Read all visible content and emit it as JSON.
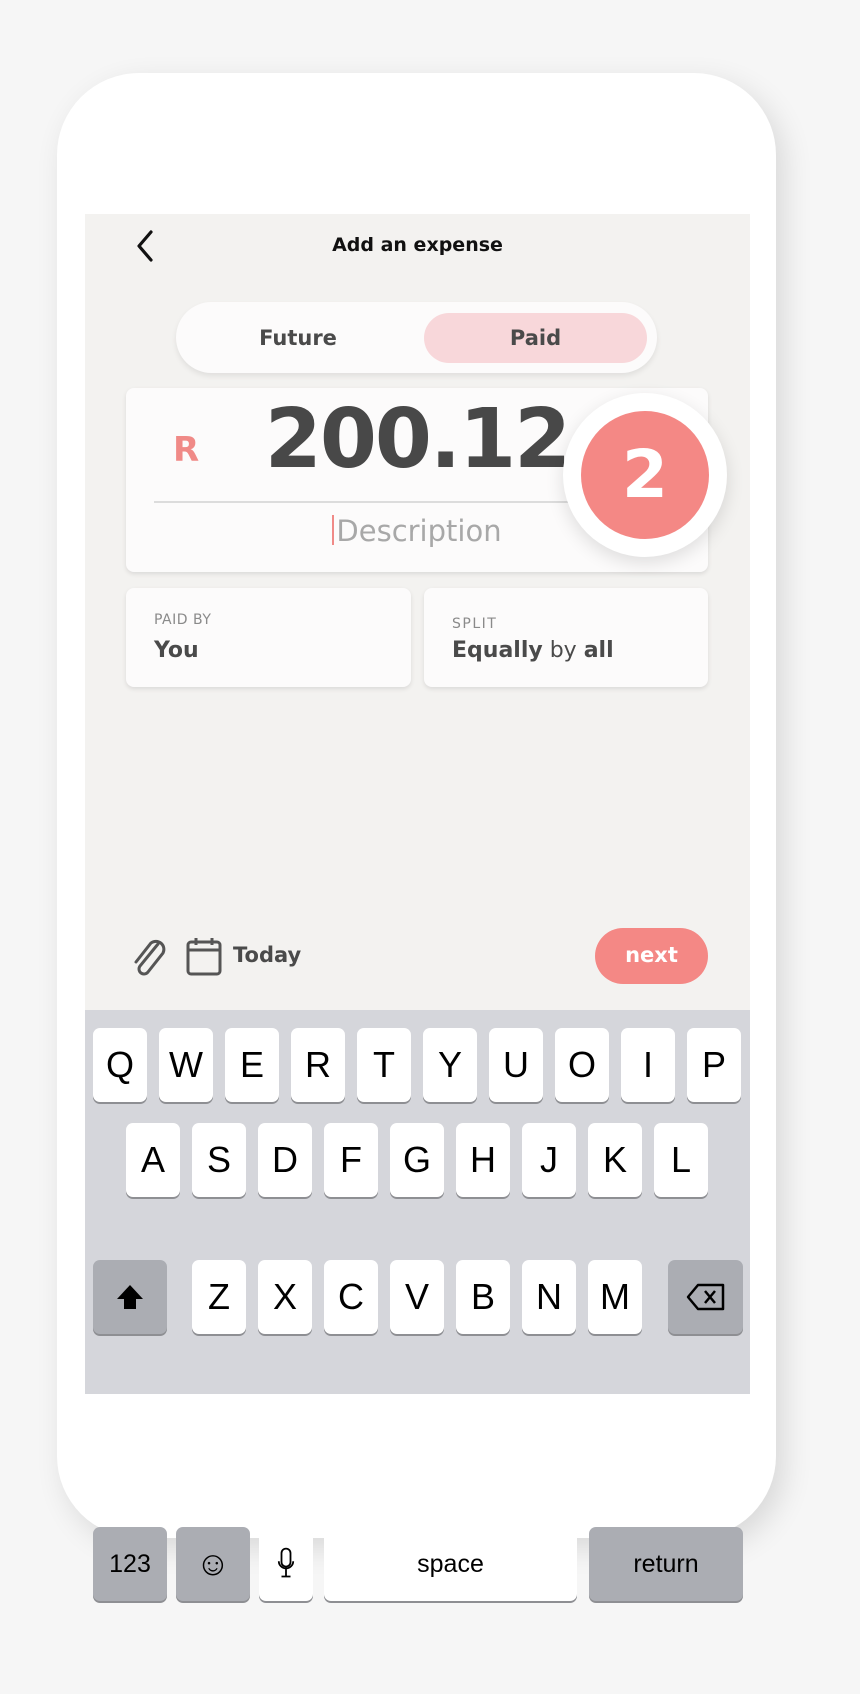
{
  "header": {
    "title": "Add an expense",
    "back_icon": "chevron-left-icon"
  },
  "toggle": {
    "options": [
      "Future",
      "Paid"
    ],
    "selected": "Paid"
  },
  "amount": {
    "currency": "R",
    "value": "200.12",
    "description_placeholder": "Description"
  },
  "badge": {
    "number": "2"
  },
  "paid_by": {
    "label": "PAID BY",
    "value": "You"
  },
  "split": {
    "label": "SPLIT",
    "value_bold1": "Equally",
    "value_mid": " by ",
    "value_bold2": "all"
  },
  "footer": {
    "date": "Today",
    "next": "next",
    "attach_icon": "paperclip-icon",
    "calendar_icon": "calendar-icon"
  },
  "keyboard": {
    "row1": [
      "Q",
      "W",
      "E",
      "R",
      "T",
      "Y",
      "U",
      "O",
      "I",
      "P"
    ],
    "row2": [
      "A",
      "S",
      "D",
      "F",
      "G",
      "H",
      "J",
      "K",
      "L"
    ],
    "row3": [
      "Z",
      "X",
      "C",
      "V",
      "B",
      "N",
      "M"
    ],
    "numbers": "123",
    "space": "space",
    "return": "return"
  },
  "colors": {
    "accent": "#f48885",
    "pill": "#f8d7da",
    "background": "#f3f2f0",
    "keyboard": "#d5d6db"
  }
}
